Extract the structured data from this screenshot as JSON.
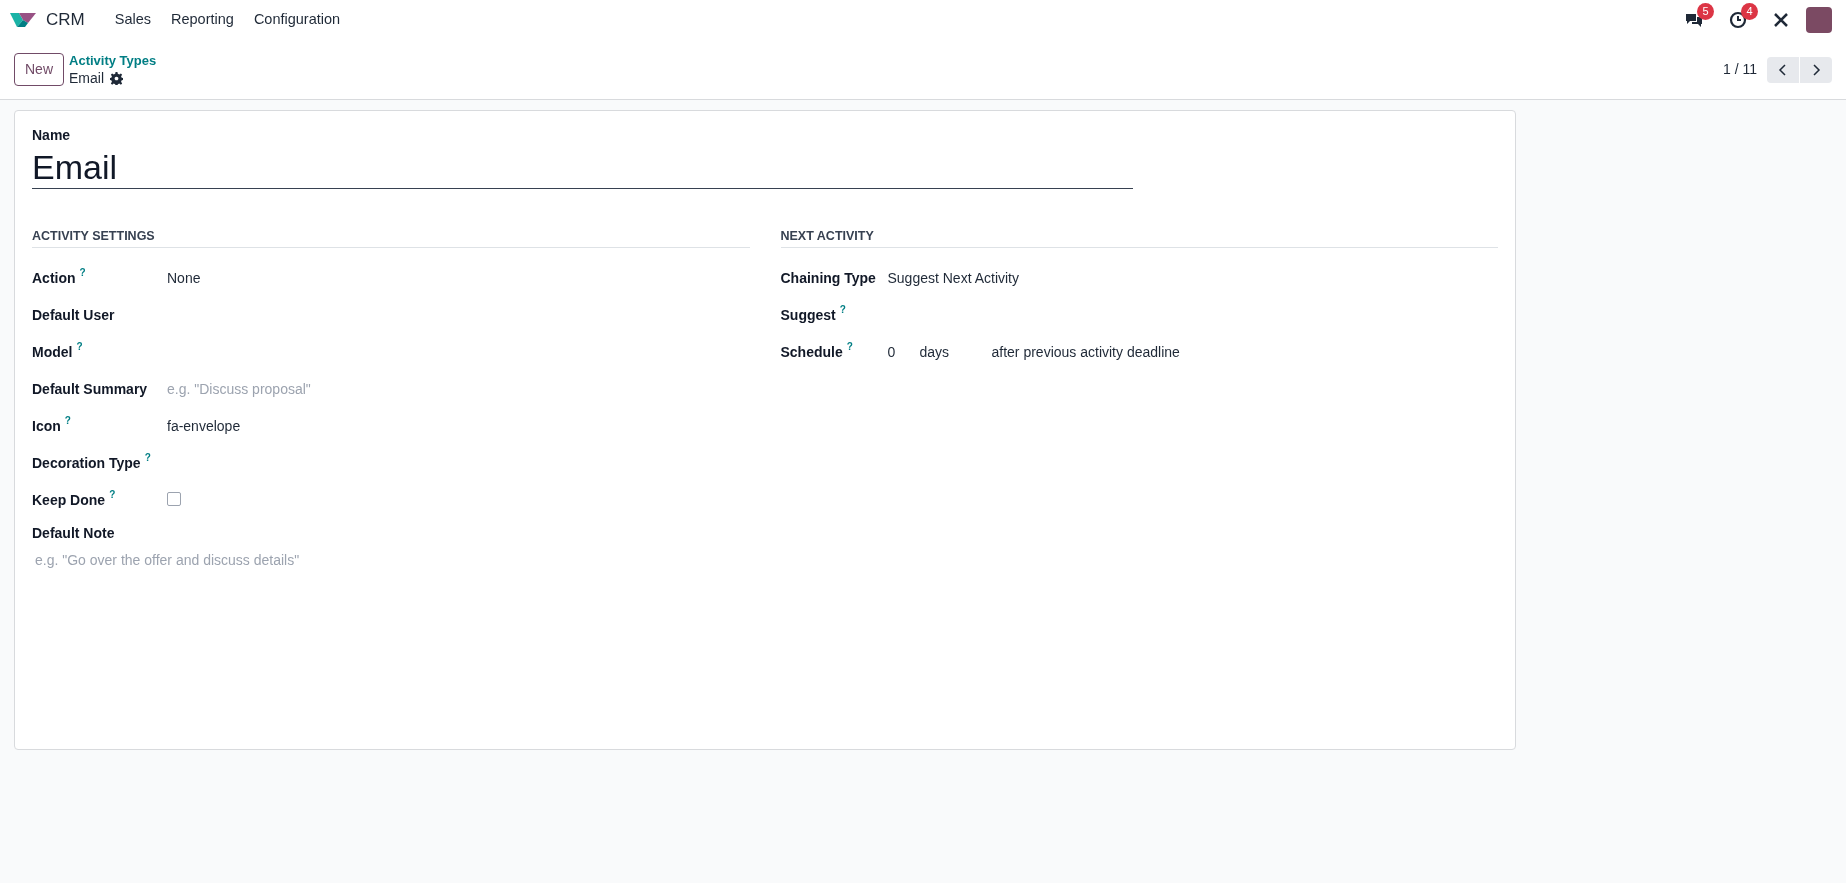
{
  "navbar": {
    "app": "CRM",
    "menus": [
      "Sales",
      "Reporting",
      "Configuration"
    ],
    "badges": [
      {
        "kind": "chat",
        "count": "5"
      },
      {
        "kind": "clock",
        "count": "4"
      }
    ]
  },
  "control_panel": {
    "new_button": "New",
    "breadcrumb": "Activity Types",
    "record": "Email",
    "pager": "1 / 11"
  },
  "form": {
    "name_label": "Name",
    "name_value": "Email",
    "sections": [
      {
        "title": "ACTIVITY SETTINGS",
        "fields": [
          {
            "label": "Action",
            "help": "?",
            "kind": "text",
            "value": "None"
          },
          {
            "label": "Default User",
            "kind": "empty"
          },
          {
            "label": "Model",
            "help": "?",
            "kind": "empty"
          },
          {
            "label": "Default Summary",
            "kind": "placeholder",
            "placeholder": "e.g. \"Discuss proposal\""
          },
          {
            "label": "Icon",
            "help": "?",
            "kind": "text",
            "value": "fa-envelope"
          },
          {
            "label": "Decoration Type",
            "help": "?",
            "kind": "empty"
          },
          {
            "label": "Keep Done",
            "help": "?",
            "kind": "checkbox",
            "checked": false
          },
          {
            "label": "Default Note",
            "kind": "note",
            "placeholder": "e.g. \"Go over the offer and discuss details\""
          }
        ]
      },
      {
        "title": "NEXT ACTIVITY",
        "fields": [
          {
            "label": "Chaining Type",
            "kind": "text",
            "value": "Suggest Next Activity"
          },
          {
            "label": "Suggest",
            "help": "?",
            "kind": "empty"
          },
          {
            "label": "Schedule",
            "help": "?",
            "kind": "schedule",
            "parts": [
              "0",
              "days",
              "after previous activity deadline"
            ]
          }
        ]
      }
    ]
  }
}
